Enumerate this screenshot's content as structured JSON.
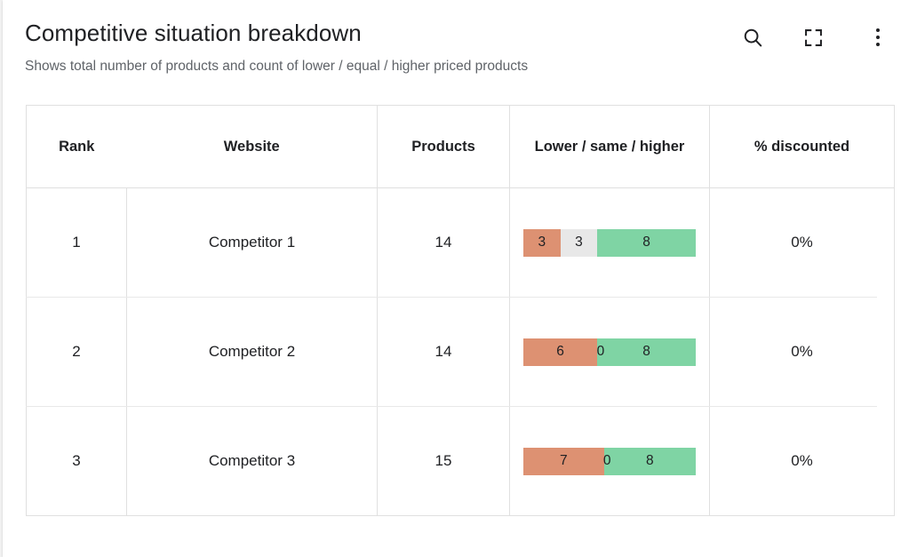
{
  "card": {
    "title": "Competitive situation breakdown",
    "subtitle": "Shows total number of products and count of lower / equal / higher priced products"
  },
  "header_actions": [
    {
      "name": "search-icon",
      "label": "Search"
    },
    {
      "name": "fullscreen-icon",
      "label": "Expand to full screen"
    },
    {
      "name": "more-vert-icon",
      "label": "More options"
    }
  ],
  "table": {
    "columns": [
      "Rank",
      "Website",
      "Products",
      "Lower / same / higher",
      "% discounted"
    ],
    "rows": [
      {
        "rank": "1",
        "website": "Competitor 1",
        "products": "14",
        "lower": "3",
        "same": "3",
        "higher": "8",
        "discounted": "0%"
      },
      {
        "rank": "2",
        "website": "Competitor 2",
        "products": "14",
        "lower": "6",
        "same": "0",
        "higher": "8",
        "discounted": "0%"
      },
      {
        "rank": "3",
        "website": "Competitor 3",
        "products": "15",
        "lower": "7",
        "same": "0",
        "higher": "8",
        "discounted": "0%"
      }
    ]
  },
  "chart_data": {
    "type": "bar",
    "title": "Competitive situation breakdown",
    "subtitle": "Shows total number of products and count of lower / equal / higher priced products",
    "orientation": "horizontal",
    "stacked": true,
    "categories": [
      "Competitor 1",
      "Competitor 2",
      "Competitor 3"
    ],
    "series": [
      {
        "name": "Lower",
        "values": [
          3,
          6,
          7
        ],
        "color": "#dd9172"
      },
      {
        "name": "Same",
        "values": [
          3,
          0,
          0
        ],
        "color": "#e8e8e8"
      },
      {
        "name": "Higher",
        "values": [
          8,
          8,
          8
        ],
        "color": "#7fd4a4"
      }
    ],
    "totals": [
      14,
      14,
      15
    ],
    "bar_totals_note": "Each bar is drawn to a constant pixel width; segment widths are proportional to the row total.",
    "xlabel": "",
    "ylabel": "",
    "grid": false,
    "legend": "none"
  },
  "colors": {
    "lower": "#dd9172",
    "same": "#e8e8e8",
    "higher": "#7fd4a4",
    "card_background": "#ffffff",
    "page_background": "#f1f1f1",
    "text_primary": "#202124",
    "text_secondary": "#5f6368",
    "border": "#e0e0e0"
  }
}
